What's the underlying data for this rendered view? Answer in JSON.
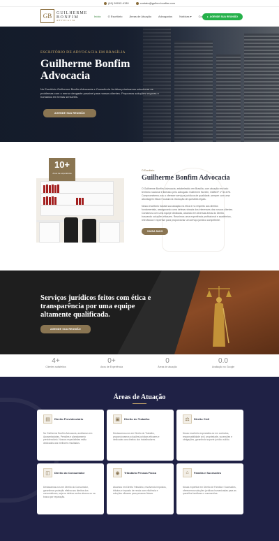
{
  "topbar": {
    "phone": "(61) 99912-4130",
    "email": "contato@gulher-bonfim.com"
  },
  "header": {
    "logo_mark": "GB",
    "logo_line1": "GUILHERME",
    "logo_line2": "BONFIM",
    "logo_line3": "ADVOCACIA",
    "nav": [
      "Início",
      "O Escritório",
      "Áreas de Atuação",
      "Advogados",
      "Notícias",
      "Contato"
    ],
    "cta": "AGENDE SUA REUNIÃO"
  },
  "hero": {
    "eyebrow": "ESCRITÓRIO DE ADVOCACIA EM BRASÍLIA",
    "title": "Guilherme Bonfim Advocacia",
    "text": "No Escritório Guilherme Bonfim Advocacia e Consultoria Jurídica priorizamos solucionar os problemas com o menor desgaste possível para nossos clientes. Propomos soluções seguras e humanas em temas sensíveis.",
    "button": "AGENDE SUA REUNIÃO"
  },
  "about": {
    "counter_value": "10+",
    "counter_label": "Anos de experiência",
    "eyebrow": "O Escritório",
    "title": "Guilherme Bonfim Advocacia",
    "p1": "O Guilherme Bonfim Advocacia, estabelecido em Brasília, com atuação em todo território nacional é liderado pelo advogado Guilherme Bonfim, OAB/DF nº 63.876. Comprometemo-nos a oferecer serviços jurídicos de qualidade, sempre com uma abordagem ética e focada na resolução de questões legais.",
    "p2": "Nosso escritório baseia sua atuação na ética e no respeito aos direitos fundamentais, assegurando uma defesa robusta dos interesses dos nossos clientes. Contamos com uma equipe dedicada, atuando em diversas áreas do Direito, buscando soluções eficazes. Reunimos uma experiência profissional e acadêmica, relevância e expertise para proporcionar um serviço jurídico competente.",
    "button": "SAIBA MAIS"
  },
  "banner": {
    "title": "Serviços jurídicos feitos com ética e transparência por uma equipe altamente qualificada.",
    "button": "AGENDE SUA REUNIÃO"
  },
  "stats": [
    {
      "value": "4+",
      "label": "Clientes satisfeitos"
    },
    {
      "value": "0+",
      "label": "Anos de Experiência"
    },
    {
      "value": "0",
      "label": "Áreas de atuação"
    },
    {
      "value": "0.0",
      "label": "Avaliação no Google"
    }
  ],
  "areas": {
    "title": "Áreas de Atuação",
    "cards": [
      {
        "icon": "document-icon",
        "title": "Direito Previdenciário",
        "text": "No Guilherme Bonfim Advocacia, auxiliamos em Aposentadorias, Pensões e planejamento previdenciário. Nossos especialistas estão dedicados aos melhores resultados."
      },
      {
        "icon": "briefcase-icon",
        "title": "Direito do Trabalho",
        "text": "Destacamos-nos em Direito do Trabalho, proporcionamos soluções jurídicas eficazes e dedicadas aos direitos dos trabalhadores."
      },
      {
        "icon": "scale-icon",
        "title": "Direito Civil",
        "text": "Nosso escritório especializa-se em contratos, responsabilidade civil, propriedade, sucessões e obrigações, garantindo suporte jurídico sólido."
      },
      {
        "icon": "cart-icon",
        "title": "Direito do Consumidor",
        "text": "Destacamos-nos em Direito do Consumidor, garantimos proteção efetiva aos direitos dos consumidores, seja na defesa contra abusos ou na busca por reparação."
      },
      {
        "icon": "person-icon",
        "title": "Tributário Pessoa Física",
        "text": "Atuamos em Direito Tributário, resolvendo impostos, tributos e imposto de renda com eficiência e soluções eficazes para pessoas físicas."
      },
      {
        "icon": "house-icon",
        "title": "Família e Sucessões",
        "text": "Nossa expertise em Direito de Família e Sucessões, oferecemos soluções jurídicas humanizadas para as questões familiares e sucessórias."
      }
    ]
  },
  "colors": {
    "gold": "#8a7552",
    "navy": "#1f2145",
    "cta_green": "#25b14a"
  }
}
